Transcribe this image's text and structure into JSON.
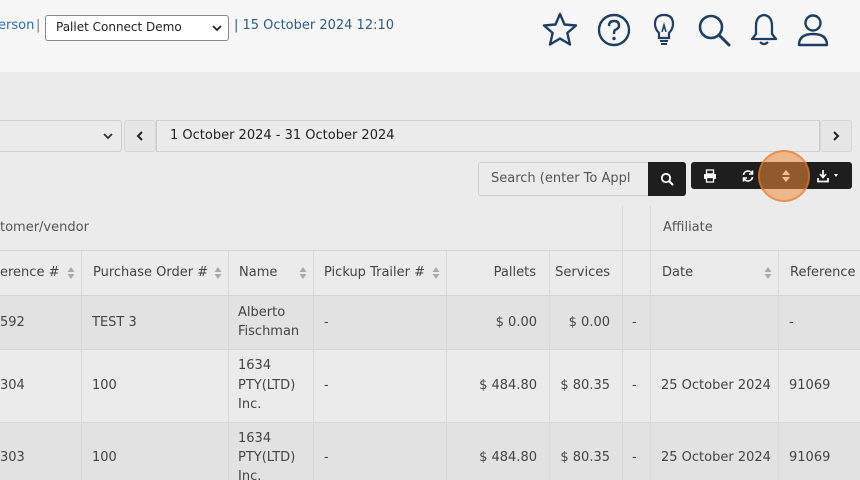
{
  "header": {
    "user_fragment": "erson",
    "separator": "|",
    "company_select": "Pallet Connect Demo",
    "datetime": "| 15 October 2024 12:10",
    "icons": [
      "star-icon",
      "help-icon",
      "lightbulb-icon",
      "search-icon",
      "bell-icon",
      "user-icon"
    ]
  },
  "filters": {
    "date_range": "1 October 2024 - 31 October 2024",
    "prev_label": "‹",
    "next_label": "›"
  },
  "search": {
    "placeholder": "Search (enter To Appl"
  },
  "toolbar": {
    "buttons": [
      "print-icon",
      "refresh-icon",
      "sort-icon",
      "download-icon"
    ]
  },
  "table": {
    "groups": {
      "customer": "tomer/vendor",
      "affiliate": "Affiliate"
    },
    "columns": {
      "reference": "erence #",
      "po": "Purchase Order #",
      "name": "Name",
      "pickup": "Pickup Trailer #",
      "pallets": "Pallets",
      "services": "Services",
      "date": "Date",
      "aff_reference": "Reference"
    },
    "rows": [
      {
        "ref": "592",
        "po": "TEST 3",
        "name1": "Alberto",
        "name2": "Fischman",
        "name3": "",
        "pickup": "-",
        "pallets": "$ 0.00",
        "services": "$ 0.00",
        "dash": "-",
        "date": "",
        "aff_ref": "-"
      },
      {
        "ref": "304",
        "po": "100",
        "name1": "1634",
        "name2": "PTY(LTD)",
        "name3": "Inc.",
        "pickup": "-",
        "pallets": "$ 484.80",
        "services": "$ 80.35",
        "dash": "-",
        "date": "25 October 2024",
        "aff_ref": "91069"
      },
      {
        "ref": "303",
        "po": "100",
        "name1": "1634",
        "name2": "PTY(LTD)",
        "name3": "Inc.",
        "pickup": "-",
        "pallets": "$ 484.80",
        "services": "$ 80.35",
        "dash": "-",
        "date": "25 October 2024",
        "aff_ref": "91069"
      }
    ]
  },
  "colors": {
    "link": "#2b6fb5",
    "toolbar": "#1e1e1e",
    "highlight": "#f08c3c"
  }
}
